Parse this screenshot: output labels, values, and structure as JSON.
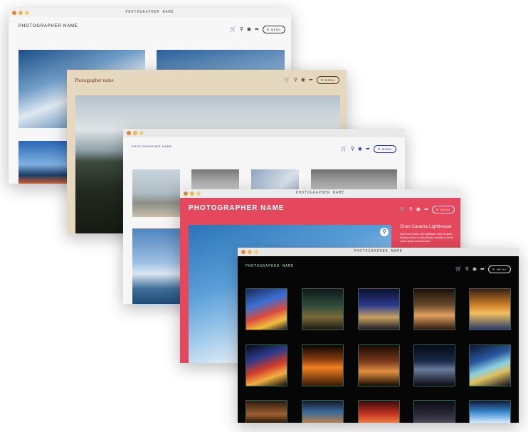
{
  "colors": {
    "win1_bg": "#f7f7f7",
    "win2_bg": "#e5d8bf",
    "win2_brand": "#6b3b22",
    "win3_bg": "#f6f6f6",
    "win3_brand": "#27358f",
    "win4_bg": "#e5485c",
    "win5_bg": "#060606",
    "win5_brand": "#9fe6c2",
    "dot_red": "#e0863b",
    "dot_yellow": "#e8b94a",
    "dot_green": "#e8d28a"
  },
  "windows": {
    "w1": {
      "title": "PHOTOGRAPHER NAME",
      "brand": "PHOTOGRAPHER NAME",
      "menu": "MENU"
    },
    "w2": {
      "brand": "Photographer name",
      "menu": "MENU"
    },
    "w3": {
      "brand": "PHOTOGRAPHER NAME",
      "menu": "MENU"
    },
    "w4": {
      "title": "PHOTOGRAPHER NAME",
      "brand": "PHOTOGRAPHER NAME",
      "menu": "MENU",
      "caption_title": "Gran Canaria Lighthouse",
      "caption_text": "Duis lorem ipsum sed sollicitudin dolor sit amet. Nullam id dolor id nibh ultricies vehicula ut id elit. Lorem ipsum dolor sit amet."
    },
    "w5": {
      "title": "PHOTOGRAPHER NAME",
      "brand": "PHOTOGRAPHER NAME",
      "menu": "MENU"
    }
  },
  "icons": {
    "cart": "cart-icon",
    "search": "search-icon",
    "account": "account-icon",
    "share": "share-icon",
    "menu": "hamburger-icon",
    "zoom": "zoom-icon"
  }
}
